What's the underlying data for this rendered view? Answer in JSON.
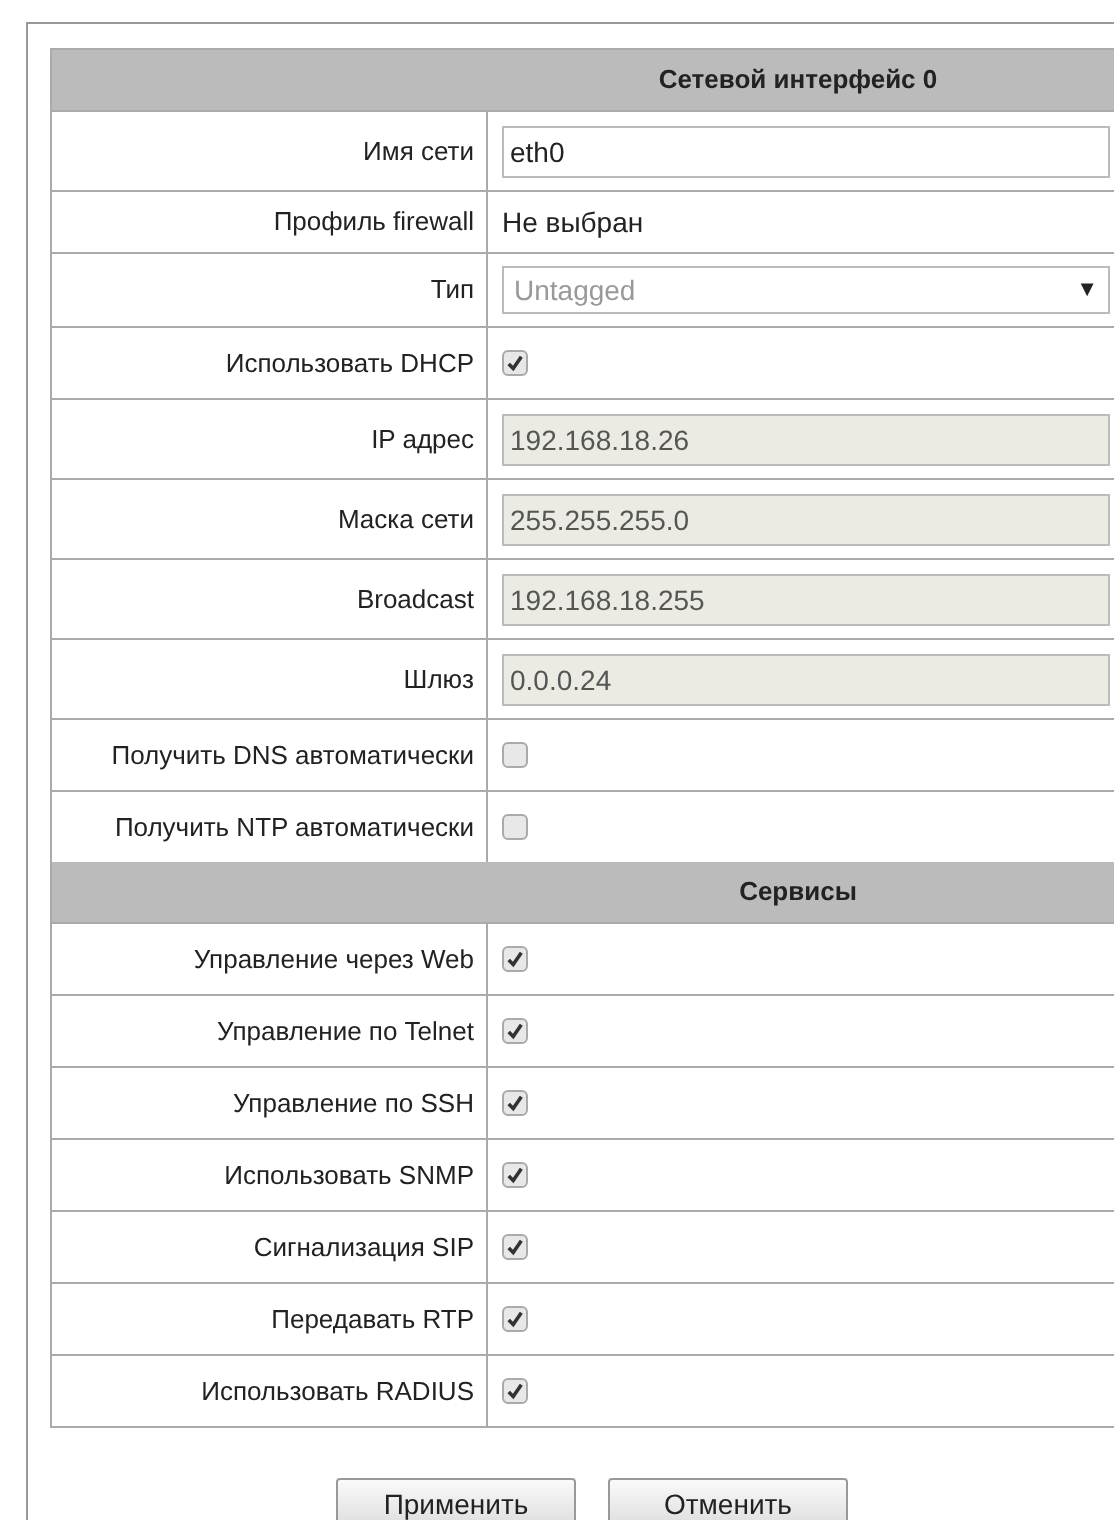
{
  "sections": [
    {
      "title": "Сетевой интерфейс 0",
      "rows": [
        {
          "label": "Имя сети",
          "kind": "input",
          "value": "eth0",
          "disabled": false
        },
        {
          "label": "Профиль firewall",
          "kind": "text",
          "value": "Не выбран"
        },
        {
          "label": "Тип",
          "kind": "select",
          "value": "Untagged",
          "arrow": "▼"
        },
        {
          "label": "Использовать DHCP",
          "kind": "checkbox",
          "checked": true
        },
        {
          "label": "IP адрес",
          "kind": "input",
          "value": "192.168.18.26",
          "disabled": true
        },
        {
          "label": "Маска сети",
          "kind": "input",
          "value": "255.255.255.0",
          "disabled": true
        },
        {
          "label": "Broadcast",
          "kind": "input",
          "value": "192.168.18.255",
          "disabled": true
        },
        {
          "label": "Шлюз",
          "kind": "input",
          "value": "0.0.0.24",
          "disabled": true
        },
        {
          "label": "Получить DNS автоматически",
          "kind": "checkbox",
          "checked": false
        },
        {
          "label": "Получить NTP автоматически",
          "kind": "checkbox",
          "checked": false
        }
      ]
    },
    {
      "title": "Сервисы",
      "rows": [
        {
          "label": "Управление через Web",
          "kind": "checkbox",
          "checked": true
        },
        {
          "label": "Управление по Telnet",
          "kind": "checkbox",
          "checked": true
        },
        {
          "label": "Управление по SSH",
          "kind": "checkbox",
          "checked": true
        },
        {
          "label": "Использовать SNMP",
          "kind": "checkbox",
          "checked": true
        },
        {
          "label": "Сигнализация SIP",
          "kind": "checkbox",
          "checked": true
        },
        {
          "label": "Передавать RTP",
          "kind": "checkbox",
          "checked": true
        },
        {
          "label": "Использовать RADIUS",
          "kind": "checkbox",
          "checked": true
        }
      ]
    }
  ],
  "buttons": [
    "Применить",
    "Отменить"
  ]
}
